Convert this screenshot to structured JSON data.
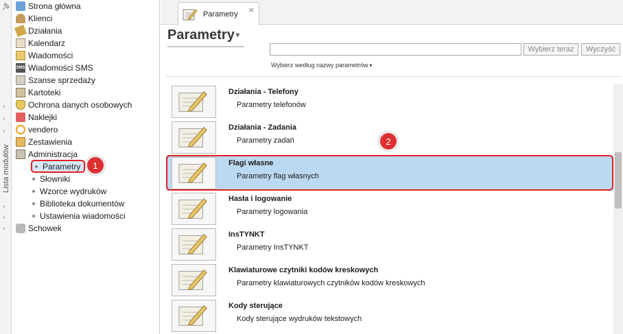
{
  "sidebar_strip": {
    "label": "Lista modułów"
  },
  "sidebar": {
    "items": [
      {
        "label": "Strona główna",
        "icon": "home-icon"
      },
      {
        "label": "Klienci",
        "icon": "clients-icon"
      },
      {
        "label": "Działania",
        "icon": "actions-icon"
      },
      {
        "label": "Kalendarz",
        "icon": "calendar-icon"
      },
      {
        "label": "Wiadomości",
        "icon": "messages-icon"
      },
      {
        "label": "Wiadomości SMS",
        "icon": "sms-icon"
      },
      {
        "label": "Szanse sprzedaży",
        "icon": "sales-icon"
      },
      {
        "label": "Kartoteki",
        "icon": "card-file-icon"
      },
      {
        "label": "Ochrona danych osobowych",
        "icon": "shield-icon"
      },
      {
        "label": "Naklejki",
        "icon": "label-icon"
      },
      {
        "label": "vendero",
        "icon": "vendero-icon"
      },
      {
        "label": "Zestawienia",
        "icon": "reports-icon"
      },
      {
        "label": "Administracja",
        "icon": "admin-icon"
      }
    ],
    "admin_children": [
      {
        "label": "Parametry",
        "active": true
      },
      {
        "label": "Słowniki"
      },
      {
        "label": "Wzorce wydruków"
      },
      {
        "label": "Biblioteka dokumentów"
      },
      {
        "label": "Ustawienia wiadomości"
      }
    ],
    "last_item": {
      "label": "Schowek",
      "icon": "clipboard-icon"
    },
    "sms_icon_text": "SMS"
  },
  "badges": {
    "one": "1",
    "two": "2"
  },
  "tab": {
    "label": "Parametry",
    "close": "×"
  },
  "page": {
    "title": "Parametry",
    "title_caret": "▾",
    "search_value": "",
    "choose_button": "Wybierz teraz",
    "clear_button": "Wyczyść",
    "filter_link": "Wybierz według nazwy parametrów",
    "filter_caret": "▾"
  },
  "parameters": [
    {
      "title": "Działania - Telefony",
      "desc": "Parametry telefonów"
    },
    {
      "title": "Działania - Zadania",
      "desc": "Parametry zadań"
    },
    {
      "title": "Flagi własne",
      "desc": "Parametry flag własnych",
      "selected": true
    },
    {
      "title": "Hasła i logowanie",
      "desc": "Parametry logowania"
    },
    {
      "title": "InsTYNKT",
      "desc": "Parametry InsTYNKT"
    },
    {
      "title": "Klawiaturowe czytniki kodów kreskowych",
      "desc": "Parametry klawiaturowych czytników kodów kreskowych"
    },
    {
      "title": "Kody sterujące",
      "desc": "Kody sterujące wydruków tekstowych"
    }
  ],
  "colors": {
    "selection": "#bcd9f2",
    "highlight_outline": "#e02020",
    "badge": "#dd3030"
  }
}
